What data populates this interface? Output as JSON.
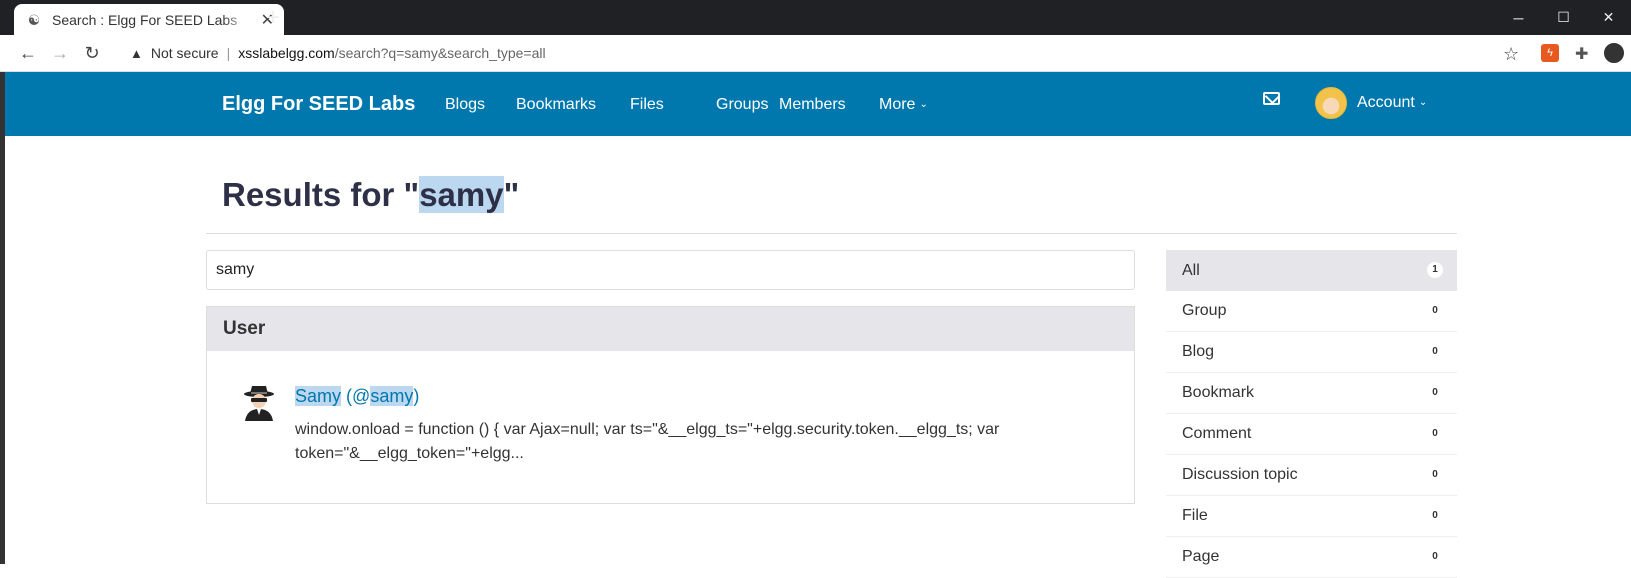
{
  "browser": {
    "tab_title": "Search : Elgg For SEED Labs",
    "new_tab": "+",
    "security_label": "Not secure",
    "url_host": "xsslabelgg.com",
    "url_path": "/search?q=samy&search_type=all"
  },
  "site": {
    "brand": "Elgg For SEED Labs",
    "menu": [
      "Blogs",
      "Bookmarks",
      "Files",
      "Groups",
      "Members"
    ],
    "more_label": "More",
    "account_label": "Account"
  },
  "page": {
    "heading_prefix": "Results for \"",
    "heading_term": "samy",
    "heading_suffix": "\"",
    "search_value": "samy"
  },
  "results": {
    "section_title": "User",
    "user_name": "Samy",
    "user_handle_prefix": "(@",
    "user_handle": "samy",
    "user_handle_suffix": ")",
    "snippet": "window.onload = function () { var Ajax=null; var ts=\"&__elgg_ts=\"+elgg.security.token.__elgg_ts; var token=\"&__elgg_token=\"+elgg..."
  },
  "sidebar": {
    "items": [
      {
        "label": "All",
        "count": "1"
      },
      {
        "label": "Group",
        "count": "0"
      },
      {
        "label": "Blog",
        "count": "0"
      },
      {
        "label": "Bookmark",
        "count": "0"
      },
      {
        "label": "Comment",
        "count": "0"
      },
      {
        "label": "Discussion topic",
        "count": "0"
      },
      {
        "label": "File",
        "count": "0"
      },
      {
        "label": "Page",
        "count": "0"
      }
    ]
  }
}
